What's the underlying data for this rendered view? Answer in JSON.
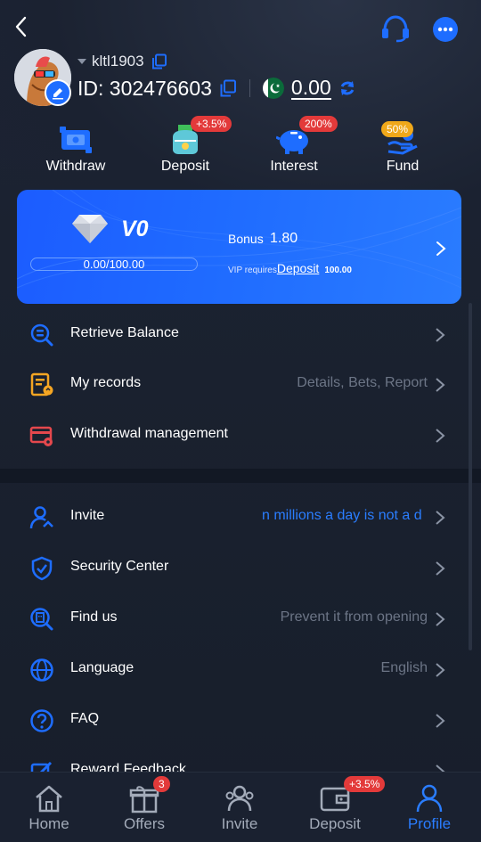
{
  "profile": {
    "username": "kltl1903",
    "id_label": "ID: 302476603",
    "balance": "0.00"
  },
  "quick_actions": [
    {
      "label": "Withdraw",
      "icon": "wallet-icon",
      "tag": ""
    },
    {
      "label": "Deposit",
      "icon": "money-pouch-icon",
      "tag": "+3.5%"
    },
    {
      "label": "Interest",
      "icon": "piggy-bank-icon",
      "tag": "200%"
    },
    {
      "label": "Fund",
      "icon": "fund-hand-icon",
      "tag": "50%"
    }
  ],
  "vip": {
    "level": "V0",
    "progress_text": "0.00/100.00",
    "progress_fraction": 0.0,
    "bonus_label": "Bonus",
    "bonus_value": "1.80",
    "requires_label": "VIP requires",
    "deposit_link": "Deposit",
    "requires_amount": "100.00"
  },
  "menu_group1": [
    {
      "label": "Retrieve Balance",
      "icon": "retrieve-balance-icon",
      "extra": ""
    },
    {
      "label": "My records",
      "icon": "records-icon",
      "extra": "Details, Bets, Report"
    },
    {
      "label": "Withdrawal management",
      "icon": "card-gear-icon",
      "extra": ""
    }
  ],
  "menu_group2": [
    {
      "label": "Invite",
      "icon": "invite-user-icon",
      "extra": "n millions a day is not a d"
    },
    {
      "label": "Security Center",
      "icon": "shield-check-icon",
      "extra": ""
    },
    {
      "label": "Find us",
      "icon": "find-building-icon",
      "extra": "Prevent it from opening"
    },
    {
      "label": "Language",
      "icon": "globe-icon",
      "extra": "English"
    },
    {
      "label": "FAQ",
      "icon": "question-icon",
      "extra": ""
    },
    {
      "label": "Reward Feedback",
      "icon": "edit-icon",
      "extra": ""
    }
  ],
  "bottom_nav": [
    {
      "label": "Home",
      "icon": "home-icon",
      "badge": ""
    },
    {
      "label": "Offers",
      "icon": "gift-icon",
      "badge": "3"
    },
    {
      "label": "Invite",
      "icon": "users-icon",
      "badge": ""
    },
    {
      "label": "Deposit",
      "icon": "wallet-icon",
      "badge": "+3.5%"
    },
    {
      "label": "Profile",
      "icon": "profile-icon",
      "badge": ""
    }
  ],
  "colors": {
    "accent": "#2a7dff",
    "badge_red": "#e33a3a",
    "badge_gold": "#f0a81a",
    "vip_card": "#1f6bff"
  }
}
